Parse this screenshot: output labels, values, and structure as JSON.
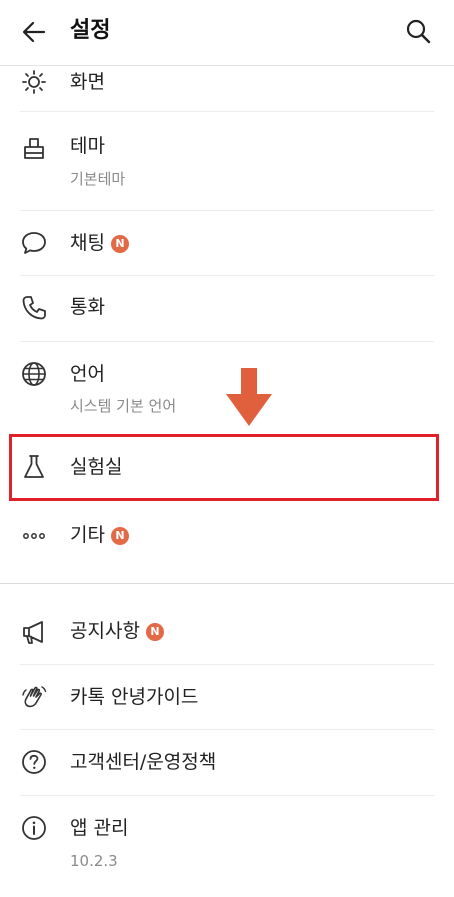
{
  "header": {
    "title": "설정",
    "back_icon": "back-arrow-icon",
    "search_icon": "search-icon"
  },
  "items": [
    {
      "id": "display",
      "label": "화면",
      "icon": "brightness-icon"
    },
    {
      "id": "theme",
      "label": "테마",
      "sub": "기본테마",
      "icon": "paintbrush-icon"
    },
    {
      "id": "chat",
      "label": "채팅",
      "badge": "N",
      "icon": "chat-bubble-icon"
    },
    {
      "id": "call",
      "label": "통화",
      "icon": "phone-icon"
    },
    {
      "id": "language",
      "label": "언어",
      "sub": "시스템 기본 언어",
      "icon": "globe-icon"
    },
    {
      "id": "labs",
      "label": "실험실",
      "icon": "flask-icon"
    },
    {
      "id": "etc",
      "label": "기타",
      "badge": "N",
      "icon": "more-dots-icon"
    },
    {
      "id": "notice",
      "label": "공지사항",
      "badge": "N",
      "icon": "megaphone-icon"
    },
    {
      "id": "guide",
      "label": "카톡 안녕가이드",
      "icon": "waving-hand-icon"
    },
    {
      "id": "help",
      "label": "고객센터/운영정책",
      "icon": "question-circle-icon"
    },
    {
      "id": "app",
      "label": "앱 관리",
      "sub": "10.2.3",
      "icon": "info-circle-icon"
    }
  ],
  "colors": {
    "badge": "#e26a46",
    "highlight_box": "#e0202a",
    "annotation_arrow": "#e0603e"
  }
}
